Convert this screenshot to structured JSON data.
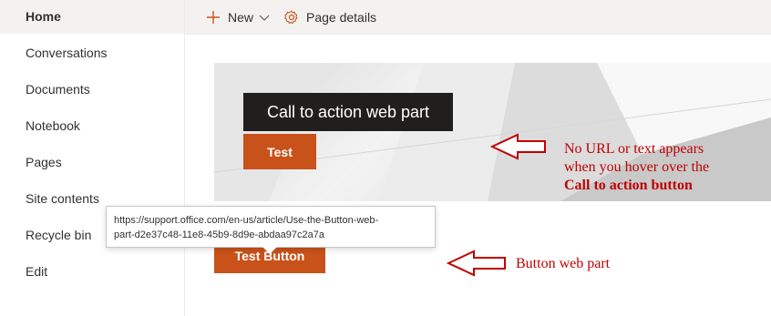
{
  "sidebar": {
    "items": [
      {
        "label": "Home",
        "selected": true
      },
      {
        "label": "Conversations"
      },
      {
        "label": "Documents"
      },
      {
        "label": "Notebook"
      },
      {
        "label": "Pages"
      },
      {
        "label": "Site contents"
      },
      {
        "label": "Recycle bin"
      },
      {
        "label": "Edit"
      }
    ]
  },
  "command_bar": {
    "new_label": "New",
    "page_details_label": "Page details",
    "accent_color": "#c9521a"
  },
  "call_to_action": {
    "title": "Call to action web part",
    "button_label": "Test"
  },
  "button_web_part": {
    "button_label": "Test Button"
  },
  "tooltip": {
    "url_line1": "https://support.office.com/en-us/article/Use-the-Button-web-",
    "url_line2": "part-d2e37c48-11e8-45b9-8d9e-abdaa97c2a7a"
  },
  "annotations": {
    "cta_note": {
      "line1": "No URL or text appears",
      "line2": "when you hover over the",
      "line3": "Call to action button"
    },
    "button_note": "Button web part",
    "color": "#c00000"
  }
}
